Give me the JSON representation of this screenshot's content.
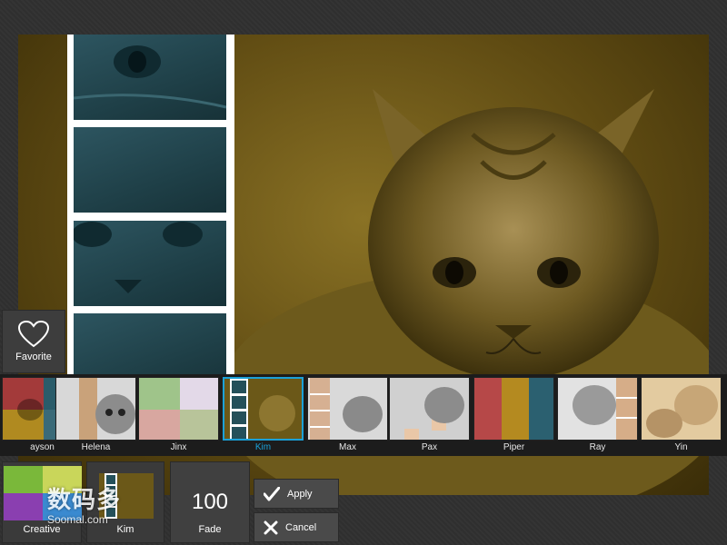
{
  "favorite": {
    "label": "Favorite",
    "icon": "heart-icon"
  },
  "filters": [
    {
      "label": "ayson",
      "selected": false
    },
    {
      "label": "Helena",
      "selected": false
    },
    {
      "label": "Jinx",
      "selected": false
    },
    {
      "label": "Kim",
      "selected": true
    },
    {
      "label": "Max",
      "selected": false
    },
    {
      "label": "Pax",
      "selected": false
    },
    {
      "label": "Piper",
      "selected": false
    },
    {
      "label": "Ray",
      "selected": false
    },
    {
      "label": "Yin",
      "selected": false
    }
  ],
  "bottom": {
    "creative_label": "Creative",
    "kim_label": "Kim",
    "fade_value": "100",
    "fade_label": "Fade",
    "apply_label": "Apply",
    "cancel_label": "Cancel"
  },
  "watermark": {
    "main": "数码多",
    "sub": "Soomal.com"
  },
  "colors": {
    "accent": "#1ba1d8",
    "gold_tint": "#7a6420",
    "teal_tint": "#24505a",
    "panel": "#3a3a3a",
    "background": "#2e2e2e"
  }
}
